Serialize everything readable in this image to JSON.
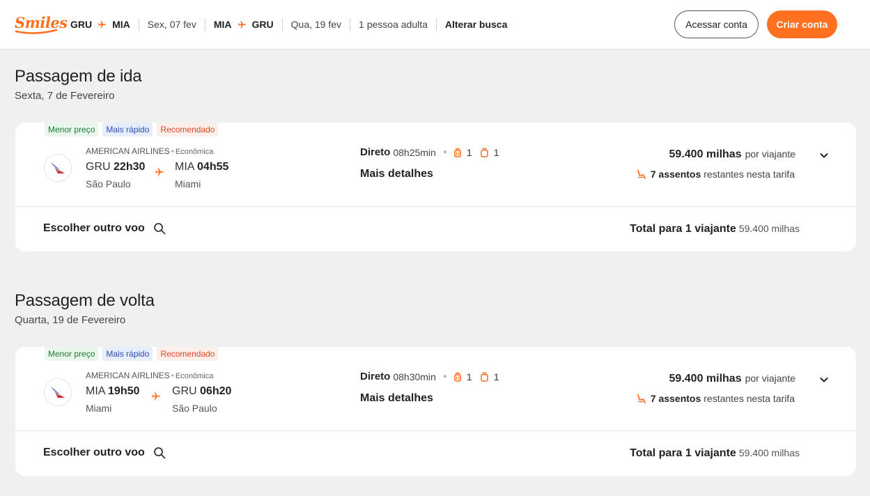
{
  "header": {
    "logo_text": "Smiles",
    "out_origin": "GRU",
    "out_dest": "MIA",
    "out_date": "Sex, 07 fev",
    "ret_origin": "MIA",
    "ret_dest": "GRU",
    "ret_date": "Qua, 19 fev",
    "passengers": "1 pessoa adulta",
    "change_search": "Alterar busca",
    "login_label": "Acessar conta",
    "create_label": "Criar conta"
  },
  "outbound": {
    "title": "Passagem de ida",
    "subtitle": "Sexta, 7 de Fevereiro",
    "tags": [
      "Menor preço",
      "Mais rápido",
      "Recomendado"
    ],
    "airline": "AMERICAN AIRLINES",
    "cabin": "Econômica",
    "dep_code": "GRU",
    "dep_time": "22h30",
    "dep_city": "São Paulo",
    "arr_code": "MIA",
    "arr_time": "04h55",
    "arr_city": "Miami",
    "stops": "Direto",
    "duration": "08h25min",
    "carry_on": "1",
    "checked": "1",
    "details_label": "Mais detalhes",
    "miles": "59.400 milhas",
    "per_traveler": "por viajante",
    "seats_count": "7 assentos",
    "seats_text": "restantes nesta tarifa",
    "choose_label": "Escolher outro voo",
    "total_label": "Total para 1 viajante",
    "total_miles": "59.400 milhas"
  },
  "inbound": {
    "title": "Passagem de volta",
    "subtitle": "Quarta, 19 de Fevereiro",
    "tags": [
      "Menor preço",
      "Mais rápido",
      "Recomendado"
    ],
    "airline": "AMERICAN AIRLINES",
    "cabin": "Econômica",
    "dep_code": "MIA",
    "dep_time": "19h50",
    "dep_city": "Miami",
    "arr_code": "GRU",
    "arr_time": "06h20",
    "arr_city": "São Paulo",
    "stops": "Direto",
    "duration": "08h30min",
    "carry_on": "1",
    "checked": "1",
    "details_label": "Mais detalhes",
    "miles": "59.400 milhas",
    "per_traveler": "por viajante",
    "seats_count": "7 assentos",
    "seats_text": "restantes nesta tarifa",
    "choose_label": "Escolher outro voo",
    "total_label": "Total para 1 viajante",
    "total_miles": "59.400 milhas"
  },
  "colors": {
    "brand_orange": "#ff7020",
    "tag_green": "#1f7a38",
    "tag_blue": "#2a4fb0",
    "tag_red": "#d9472b"
  },
  "icons": [
    "plane-icon",
    "carry-on-bag-icon",
    "checked-bag-icon",
    "seat-icon",
    "chevron-down-icon",
    "search-icon",
    "american-airlines-logo"
  ]
}
